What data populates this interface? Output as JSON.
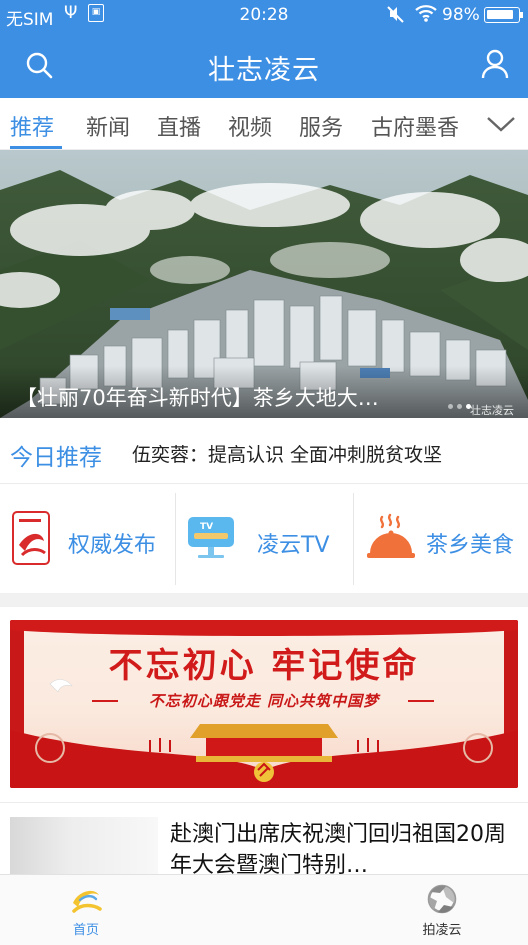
{
  "status_bar": {
    "carrier": "无SIM",
    "time": "20:28",
    "battery": "98%"
  },
  "nav": {
    "title": "壮志凌云"
  },
  "tabs": {
    "items": [
      "推荐",
      "新闻",
      "直播",
      "视频",
      "服务",
      "古府墨香"
    ],
    "active_index": 0
  },
  "banner": {
    "caption": "【壮丽70年奋斗新时代】茶乡大地大…",
    "watermark": "壮志凌云",
    "slide_count": 3,
    "active_slide": 2
  },
  "today": {
    "label": "今日推荐",
    "headline": "伍奕蓉：提高认识 全面冲刺脱贫攻坚"
  },
  "shortcuts": [
    {
      "label": "权威发布",
      "icon": "document-logo-icon"
    },
    {
      "label": "凌云TV",
      "icon": "tv-icon"
    },
    {
      "label": "茶乡美食",
      "icon": "food-dish-icon"
    }
  ],
  "promo": {
    "title": "不忘初心  牢记使命",
    "subtitle": "不忘初心跟党走 同心共筑中国梦"
  },
  "news": {
    "title": "赴澳门出席庆祝澳门回归祖国20周年大会暨澳门特别…"
  },
  "tabbar": {
    "home": "首页",
    "capture": "拍凌云"
  },
  "colors": {
    "brand_blue": "#3d8fe4",
    "promo_red": "#d11a1a",
    "food_orange": "#f0713a"
  }
}
